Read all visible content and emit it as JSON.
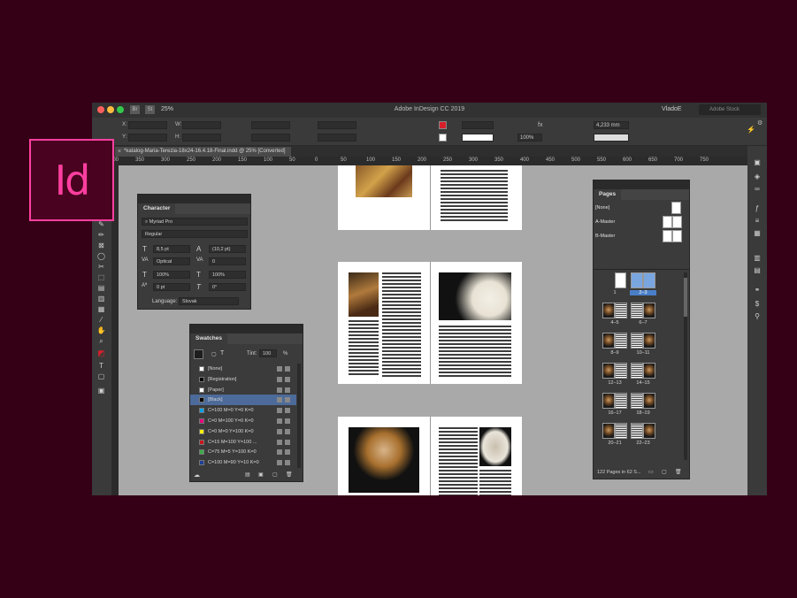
{
  "logo": {
    "text": "Id"
  },
  "window": {
    "title": "Adobe InDesign CC 2019",
    "badges": [
      "Br",
      "St"
    ],
    "zoom": "25%",
    "user": "VladoE",
    "search_placeholder": "Adobe Stock"
  },
  "control": {
    "x_label": "X:",
    "y_label": "Y:",
    "w_label": "W:",
    "h_label": "H:",
    "stroke_percent": "100%",
    "stroke_value": "4,233 mm",
    "fx_label": "fx"
  },
  "document_tab": {
    "title": "*katalog-Maria-Terezia-18x24-16.4.18-Final.indd @ 25% [Converted]"
  },
  "ruler": {
    "ticks": [
      "400",
      "350",
      "300",
      "250",
      "200",
      "150",
      "100",
      "50",
      "0",
      "50",
      "100",
      "150",
      "200",
      "250",
      "300",
      "350",
      "400",
      "450",
      "500",
      "550",
      "600",
      "650",
      "700",
      "750"
    ]
  },
  "character_panel": {
    "title": "Character",
    "font_family": "Myriad Pro",
    "font_style": "Regular",
    "font_size": "8,5 pt",
    "leading": "(10,2 pt)",
    "kerning": "Optical",
    "tracking": "0",
    "vertical_scale": "100%",
    "horizontal_scale": "100%",
    "baseline_shift": "0 pt",
    "skew": "0°",
    "language_label": "Language:",
    "language": "Slovak"
  },
  "swatches_panel": {
    "title": "Swatches",
    "tint_label": "Tint:",
    "tint_value": "100",
    "tint_unit": "%",
    "items": [
      {
        "name": "[None]",
        "color": "#ffffff"
      },
      {
        "name": "[Registration]",
        "color": "#000000"
      },
      {
        "name": "[Paper]",
        "color": "#ffffff"
      },
      {
        "name": "[Black]",
        "color": "#000000"
      },
      {
        "name": "C=100 M=0 Y=0 K=0",
        "color": "#00a0e9"
      },
      {
        "name": "C=0 M=100 Y=0 K=0",
        "color": "#e4007f"
      },
      {
        "name": "C=0 M=0 Y=100 K=0",
        "color": "#fff100"
      },
      {
        "name": "C=15 M=100 Y=100 ...",
        "color": "#c8161d"
      },
      {
        "name": "C=75 M=5 Y=100 K=0",
        "color": "#3bae49"
      },
      {
        "name": "C=100 M=90 Y=10 K=0",
        "color": "#1d3f94"
      }
    ]
  },
  "pages_panel": {
    "title": "Pages",
    "masters": [
      "[None]",
      "A-Master",
      "B-Master"
    ],
    "page_labels": [
      "1",
      "2–3",
      "4–5",
      "6–7",
      "8–9",
      "10–11",
      "12–13",
      "14–15",
      "16–17",
      "18–19",
      "20–21",
      "22–23"
    ],
    "footer": "122 Pages in 62 S..."
  }
}
